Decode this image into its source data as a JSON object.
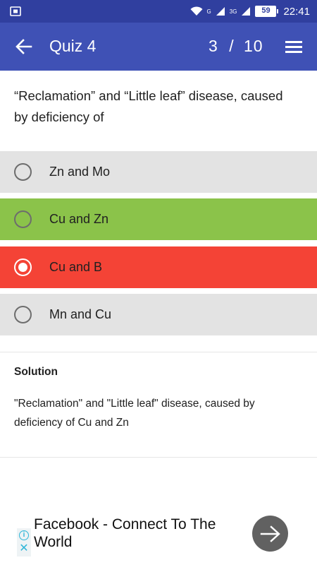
{
  "status_bar": {
    "signal_label_1": "G",
    "signal_label_2": "3G",
    "battery": "59",
    "time": "22:41"
  },
  "app_bar": {
    "title": "Quiz 4",
    "current": "3",
    "separator": "/",
    "total": "10"
  },
  "question": "“Reclamation” and “Little leaf” disease, caused by deficiency of",
  "options": [
    {
      "label": "Zn and Mo",
      "state": "neutral",
      "selected": false
    },
    {
      "label": "Cu and Zn",
      "state": "correct",
      "selected": false
    },
    {
      "label": "Cu and B",
      "state": "wrong",
      "selected": true
    },
    {
      "label": "Mn and Cu",
      "state": "neutral",
      "selected": false
    }
  ],
  "solution": {
    "title": "Solution",
    "text": "\"Reclamation\" and \"Little leaf\" disease, caused by deficiency of Cu and Zn"
  },
  "ad": {
    "title": "Facebook - Connect To The World",
    "info_icon": "i",
    "close_icon": "✕"
  },
  "colors": {
    "primary": "#3f51b5",
    "primary_dark": "#303f9f",
    "correct": "#8bc34a",
    "wrong": "#f44336",
    "neutral": "#e3e3e3"
  }
}
